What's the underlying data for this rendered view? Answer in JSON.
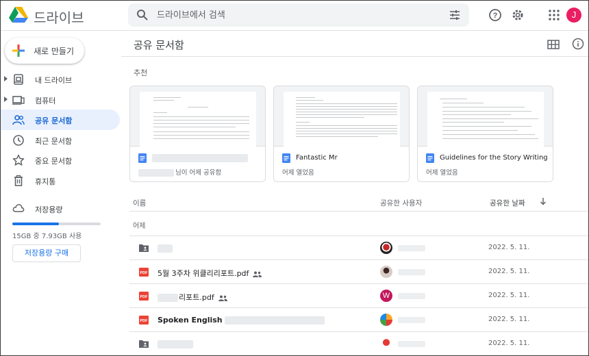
{
  "app": {
    "title": "드라이브",
    "brand_colors": {
      "blue": "#4285f4",
      "green": "#0f9d58",
      "yellow": "#f4b400",
      "red": "#db4437"
    }
  },
  "search": {
    "placeholder": "드라이브에서 검색",
    "value": ""
  },
  "header_icons": [
    "help-icon",
    "settings-icon",
    "apps-icon"
  ],
  "user": {
    "avatar_letter": "J",
    "avatar_color": "#e91e63"
  },
  "new_button": {
    "label": "새로 만들기"
  },
  "sidebar": {
    "items": [
      {
        "label": "내 드라이브",
        "icon": "my-drive-icon",
        "expandable": true,
        "active": false
      },
      {
        "label": "컴퓨터",
        "icon": "computer-icon",
        "expandable": true,
        "active": false
      },
      {
        "label": "공유 문서함",
        "icon": "shared-icon",
        "expandable": false,
        "active": true
      },
      {
        "label": "최근 문서함",
        "icon": "clock-icon",
        "expandable": false,
        "active": false
      },
      {
        "label": "중요 문서함",
        "icon": "star-icon",
        "expandable": false,
        "active": false
      },
      {
        "label": "휴지통",
        "icon": "trash-icon",
        "expandable": false,
        "active": false
      }
    ]
  },
  "storage": {
    "label": "저장용량",
    "usage_text": "15GB 중 7.93GB 사용",
    "used_fraction": 0.53,
    "buy_label": "저장용량 구매"
  },
  "main": {
    "title": "공유 문서함",
    "suggested_label": "추천",
    "cards": [
      {
        "name": "",
        "subtitle": "님이 어제 공유함"
      },
      {
        "name": "Fantastic Mr",
        "subtitle": "어제 열었음"
      },
      {
        "name": "Guidelines for the Story Writing C...",
        "subtitle": "어제 열었음"
      }
    ],
    "columns": {
      "name": "이름",
      "shared_by": "공유한 사용자",
      "shared_date": "공유한 날짜"
    },
    "group_label": "어제",
    "rows": [
      {
        "type": "folder",
        "name": "",
        "shared": false,
        "avatar_color": "#c62828",
        "date": "2022. 5. 11."
      },
      {
        "type": "pdf",
        "name": "5월 3주차 위클리리포트.pdf",
        "shared": true,
        "avatar_color": "#6d4c41",
        "date": "2022. 5. 11."
      },
      {
        "type": "pdf",
        "name": "리포트.pdf",
        "shared": true,
        "avatar_color": "#c2185b",
        "avatar_letter": "W",
        "date": "2022. 5. 11."
      },
      {
        "type": "pdf",
        "name": "Spoken English",
        "shared": false,
        "avatar_color": "#f9a825",
        "date": "2022. 5. 11."
      },
      {
        "type": "folder",
        "name": "",
        "shared": false,
        "avatar_color": "#e53935",
        "date": "2022. 5. 11."
      }
    ]
  }
}
